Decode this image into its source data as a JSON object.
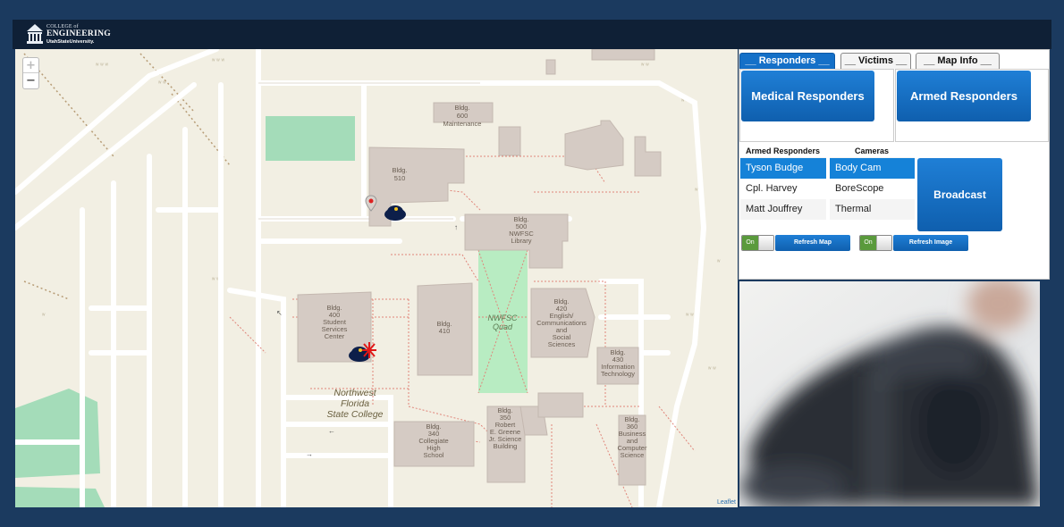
{
  "header": {
    "logo_line1": "COLLEGE of",
    "logo_line2": "ENGINEERING",
    "logo_line3": "UtahStateUniversity."
  },
  "map": {
    "zoom_in": "+",
    "zoom_out": "−",
    "attribution": "Leaflet",
    "labels": {
      "b600": [
        "Bldg.",
        "600",
        "Maintenance"
      ],
      "b510": [
        "Bldg.",
        "510"
      ],
      "b500": [
        "Bldg.",
        "500",
        "NWFSC",
        "Library"
      ],
      "b400": [
        "Bldg.",
        "400",
        "Student",
        "Services",
        "Center"
      ],
      "b410": [
        "Bldg.",
        "410"
      ],
      "quad": [
        "NWFSC",
        "Quad"
      ],
      "b420": [
        "Bldg.",
        "420",
        "English/",
        "Communications",
        "and",
        "Social",
        "Sciences"
      ],
      "b430": [
        "Bldg.",
        "430",
        "Information",
        "Technology"
      ],
      "college": [
        "Northwest",
        "Florida",
        "State College"
      ],
      "b340": [
        "Bldg.",
        "340",
        "Collegiate",
        "High",
        "School"
      ],
      "b350": [
        "Bldg.",
        "350",
        "Robert",
        "E. Greene",
        "Jr. Science",
        "Building"
      ],
      "b360": [
        "Bldg.",
        "360",
        "Business",
        "and",
        "Computer",
        "Science"
      ]
    }
  },
  "tabs": {
    "responders": "__ Responders __",
    "victims": "__ Victims __",
    "map_info": "__ Map Info __"
  },
  "responders": {
    "medical_label": "Medical Responders",
    "armed_label": "Armed Responders"
  },
  "lists": {
    "armed_header": "Armed Responders",
    "cameras_header": "Cameras",
    "armed": [
      "Tyson Budge",
      "Cpl. Harvey",
      "Matt Jouffrey"
    ],
    "cameras": [
      "Body Cam",
      "BoreScope",
      "Thermal"
    ],
    "selected_armed": "Tyson Budge",
    "selected_camera": "Body Cam"
  },
  "controls": {
    "broadcast_label": "Broadcast",
    "toggle_map": "On",
    "refresh_map": "Refresh Map",
    "toggle_image": "On",
    "refresh_image": "Refresh Image"
  },
  "colors": {
    "accent": "#1470c8",
    "page_bg": "#1b3a5f",
    "header_bg": "#0f2036",
    "map_bg": "#f2efe3",
    "building": "#d5cbc4",
    "green": "#a4dcb9"
  },
  "icons": [
    "university-logo",
    "police-officer-icon",
    "red-map-pin-icon",
    "incident-burst-icon"
  ]
}
